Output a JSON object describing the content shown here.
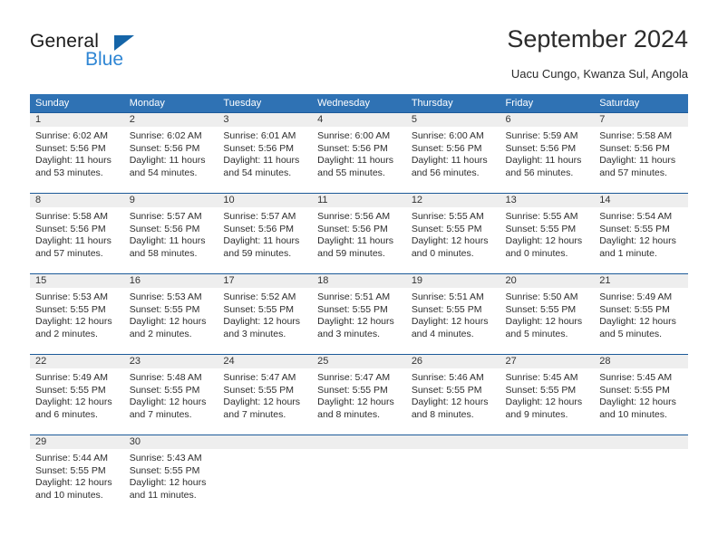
{
  "logo": {
    "word_primary": "General",
    "word_secondary": "Blue",
    "triangle_icon": "triangle-icon",
    "primary_color": "#1a1a1a",
    "secondary_color": "#2f86d4",
    "accent_color": "#1565a8"
  },
  "header": {
    "title": "September 2024",
    "subtitle": "Uacu Cungo, Kwanza Sul, Angola"
  },
  "theme": {
    "header_band": "#2f72b4",
    "daynum_band": "#eeeeee",
    "row_border": "#1c5a99",
    "text": "#2d2d2d"
  },
  "calendar": {
    "weekday_headers": [
      "Sunday",
      "Monday",
      "Tuesday",
      "Wednesday",
      "Thursday",
      "Friday",
      "Saturday"
    ],
    "weeks": [
      [
        {
          "day": "1",
          "sunrise": "Sunrise: 6:02 AM",
          "sunset": "Sunset: 5:56 PM",
          "daylight": "Daylight: 11 hours and 53 minutes."
        },
        {
          "day": "2",
          "sunrise": "Sunrise: 6:02 AM",
          "sunset": "Sunset: 5:56 PM",
          "daylight": "Daylight: 11 hours and 54 minutes."
        },
        {
          "day": "3",
          "sunrise": "Sunrise: 6:01 AM",
          "sunset": "Sunset: 5:56 PM",
          "daylight": "Daylight: 11 hours and 54 minutes."
        },
        {
          "day": "4",
          "sunrise": "Sunrise: 6:00 AM",
          "sunset": "Sunset: 5:56 PM",
          "daylight": "Daylight: 11 hours and 55 minutes."
        },
        {
          "day": "5",
          "sunrise": "Sunrise: 6:00 AM",
          "sunset": "Sunset: 5:56 PM",
          "daylight": "Daylight: 11 hours and 56 minutes."
        },
        {
          "day": "6",
          "sunrise": "Sunrise: 5:59 AM",
          "sunset": "Sunset: 5:56 PM",
          "daylight": "Daylight: 11 hours and 56 minutes."
        },
        {
          "day": "7",
          "sunrise": "Sunrise: 5:58 AM",
          "sunset": "Sunset: 5:56 PM",
          "daylight": "Daylight: 11 hours and 57 minutes."
        }
      ],
      [
        {
          "day": "8",
          "sunrise": "Sunrise: 5:58 AM",
          "sunset": "Sunset: 5:56 PM",
          "daylight": "Daylight: 11 hours and 57 minutes."
        },
        {
          "day": "9",
          "sunrise": "Sunrise: 5:57 AM",
          "sunset": "Sunset: 5:56 PM",
          "daylight": "Daylight: 11 hours and 58 minutes."
        },
        {
          "day": "10",
          "sunrise": "Sunrise: 5:57 AM",
          "sunset": "Sunset: 5:56 PM",
          "daylight": "Daylight: 11 hours and 59 minutes."
        },
        {
          "day": "11",
          "sunrise": "Sunrise: 5:56 AM",
          "sunset": "Sunset: 5:56 PM",
          "daylight": "Daylight: 11 hours and 59 minutes."
        },
        {
          "day": "12",
          "sunrise": "Sunrise: 5:55 AM",
          "sunset": "Sunset: 5:55 PM",
          "daylight": "Daylight: 12 hours and 0 minutes."
        },
        {
          "day": "13",
          "sunrise": "Sunrise: 5:55 AM",
          "sunset": "Sunset: 5:55 PM",
          "daylight": "Daylight: 12 hours and 0 minutes."
        },
        {
          "day": "14",
          "sunrise": "Sunrise: 5:54 AM",
          "sunset": "Sunset: 5:55 PM",
          "daylight": "Daylight: 12 hours and 1 minute."
        }
      ],
      [
        {
          "day": "15",
          "sunrise": "Sunrise: 5:53 AM",
          "sunset": "Sunset: 5:55 PM",
          "daylight": "Daylight: 12 hours and 2 minutes."
        },
        {
          "day": "16",
          "sunrise": "Sunrise: 5:53 AM",
          "sunset": "Sunset: 5:55 PM",
          "daylight": "Daylight: 12 hours and 2 minutes."
        },
        {
          "day": "17",
          "sunrise": "Sunrise: 5:52 AM",
          "sunset": "Sunset: 5:55 PM",
          "daylight": "Daylight: 12 hours and 3 minutes."
        },
        {
          "day": "18",
          "sunrise": "Sunrise: 5:51 AM",
          "sunset": "Sunset: 5:55 PM",
          "daylight": "Daylight: 12 hours and 3 minutes."
        },
        {
          "day": "19",
          "sunrise": "Sunrise: 5:51 AM",
          "sunset": "Sunset: 5:55 PM",
          "daylight": "Daylight: 12 hours and 4 minutes."
        },
        {
          "day": "20",
          "sunrise": "Sunrise: 5:50 AM",
          "sunset": "Sunset: 5:55 PM",
          "daylight": "Daylight: 12 hours and 5 minutes."
        },
        {
          "day": "21",
          "sunrise": "Sunrise: 5:49 AM",
          "sunset": "Sunset: 5:55 PM",
          "daylight": "Daylight: 12 hours and 5 minutes."
        }
      ],
      [
        {
          "day": "22",
          "sunrise": "Sunrise: 5:49 AM",
          "sunset": "Sunset: 5:55 PM",
          "daylight": "Daylight: 12 hours and 6 minutes."
        },
        {
          "day": "23",
          "sunrise": "Sunrise: 5:48 AM",
          "sunset": "Sunset: 5:55 PM",
          "daylight": "Daylight: 12 hours and 7 minutes."
        },
        {
          "day": "24",
          "sunrise": "Sunrise: 5:47 AM",
          "sunset": "Sunset: 5:55 PM",
          "daylight": "Daylight: 12 hours and 7 minutes."
        },
        {
          "day": "25",
          "sunrise": "Sunrise: 5:47 AM",
          "sunset": "Sunset: 5:55 PM",
          "daylight": "Daylight: 12 hours and 8 minutes."
        },
        {
          "day": "26",
          "sunrise": "Sunrise: 5:46 AM",
          "sunset": "Sunset: 5:55 PM",
          "daylight": "Daylight: 12 hours and 8 minutes."
        },
        {
          "day": "27",
          "sunrise": "Sunrise: 5:45 AM",
          "sunset": "Sunset: 5:55 PM",
          "daylight": "Daylight: 12 hours and 9 minutes."
        },
        {
          "day": "28",
          "sunrise": "Sunrise: 5:45 AM",
          "sunset": "Sunset: 5:55 PM",
          "daylight": "Daylight: 12 hours and 10 minutes."
        }
      ],
      [
        {
          "day": "29",
          "sunrise": "Sunrise: 5:44 AM",
          "sunset": "Sunset: 5:55 PM",
          "daylight": "Daylight: 12 hours and 10 minutes."
        },
        {
          "day": "30",
          "sunrise": "Sunrise: 5:43 AM",
          "sunset": "Sunset: 5:55 PM",
          "daylight": "Daylight: 12 hours and 11 minutes."
        },
        {
          "day": "",
          "sunrise": "",
          "sunset": "",
          "daylight": ""
        },
        {
          "day": "",
          "sunrise": "",
          "sunset": "",
          "daylight": ""
        },
        {
          "day": "",
          "sunrise": "",
          "sunset": "",
          "daylight": ""
        },
        {
          "day": "",
          "sunrise": "",
          "sunset": "",
          "daylight": ""
        },
        {
          "day": "",
          "sunrise": "",
          "sunset": "",
          "daylight": ""
        }
      ]
    ]
  }
}
